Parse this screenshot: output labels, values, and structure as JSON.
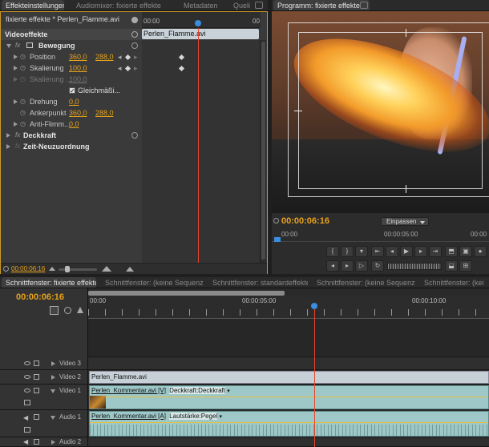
{
  "effect_panel": {
    "tabs": [
      "Effekteinstellungen",
      "Audiomixer: fixierte effekte",
      "Metadaten",
      "Queli"
    ],
    "breadcrumb": "fixierte effekte * Perlen_Flamme.avi",
    "ruler_start": "00:00",
    "ruler_end": "00",
    "clip_label": "Perlen_Flamme.avi",
    "section_title": "Videoeffekte",
    "motion": {
      "label": "Bewegung",
      "position": {
        "label": "Position",
        "x": "360,0",
        "y": "288,0"
      },
      "scale": {
        "label": "Skalierung",
        "value": "100,0"
      },
      "scale_width": {
        "label": "Skalierung ...",
        "value": "100,0"
      },
      "uniform": {
        "label": "Gleichmäßi...",
        "checked": true
      },
      "rotation": {
        "label": "Drehung",
        "value": "0,0"
      },
      "anchor": {
        "label": "Ankerpunkt",
        "x": "360,0",
        "y": "288,0"
      },
      "antiflicker": {
        "label": "Anti-Flimm...",
        "value": "0,0"
      }
    },
    "opacity_label": "Deckkraft",
    "timeremap_label": "Zeit-Neuzuordnung",
    "current_time": "00:00:06:16"
  },
  "program_monitor": {
    "title": "Programm: fixierte effekte",
    "timecode": "00:00:06:16",
    "fit_label": "Einpassen",
    "ruler_start": "00:00",
    "ruler_mid": "00:00:05:00",
    "ruler_end": "00:00"
  },
  "timeline": {
    "tabs": [
      "Schnittfenster: fixierte effekte",
      "Schnittfenster: (keine Sequenzen)",
      "Schnittfenster: standardeffekte",
      "Schnittfenster: (keine Sequenzen)",
      "Schnittfenster: (kei"
    ],
    "timecode": "00:00:06:16",
    "ruler_labels": [
      "00:00",
      "00:00:05:00",
      "00:00:10:00"
    ],
    "tracks": [
      {
        "name": "Video 3"
      },
      {
        "name": "Video 2",
        "clip": "Perlen_Flamme.avi"
      },
      {
        "name": "Video 1",
        "clip": "Perlen_Kommentar.avi [V]",
        "effect": "Deckkraft:Deckkraft"
      },
      {
        "name": "Audio 1",
        "clip": "Perlen_Kommentar.avi [A]",
        "effect": "Lautstärke:Pegel"
      },
      {
        "name": "Audio 2"
      }
    ]
  },
  "colors": {
    "accent": "#e8a21a",
    "clip": "#9ec8c8",
    "playhead": "#e8452a",
    "keyframe_marker": "#3a8de0"
  }
}
